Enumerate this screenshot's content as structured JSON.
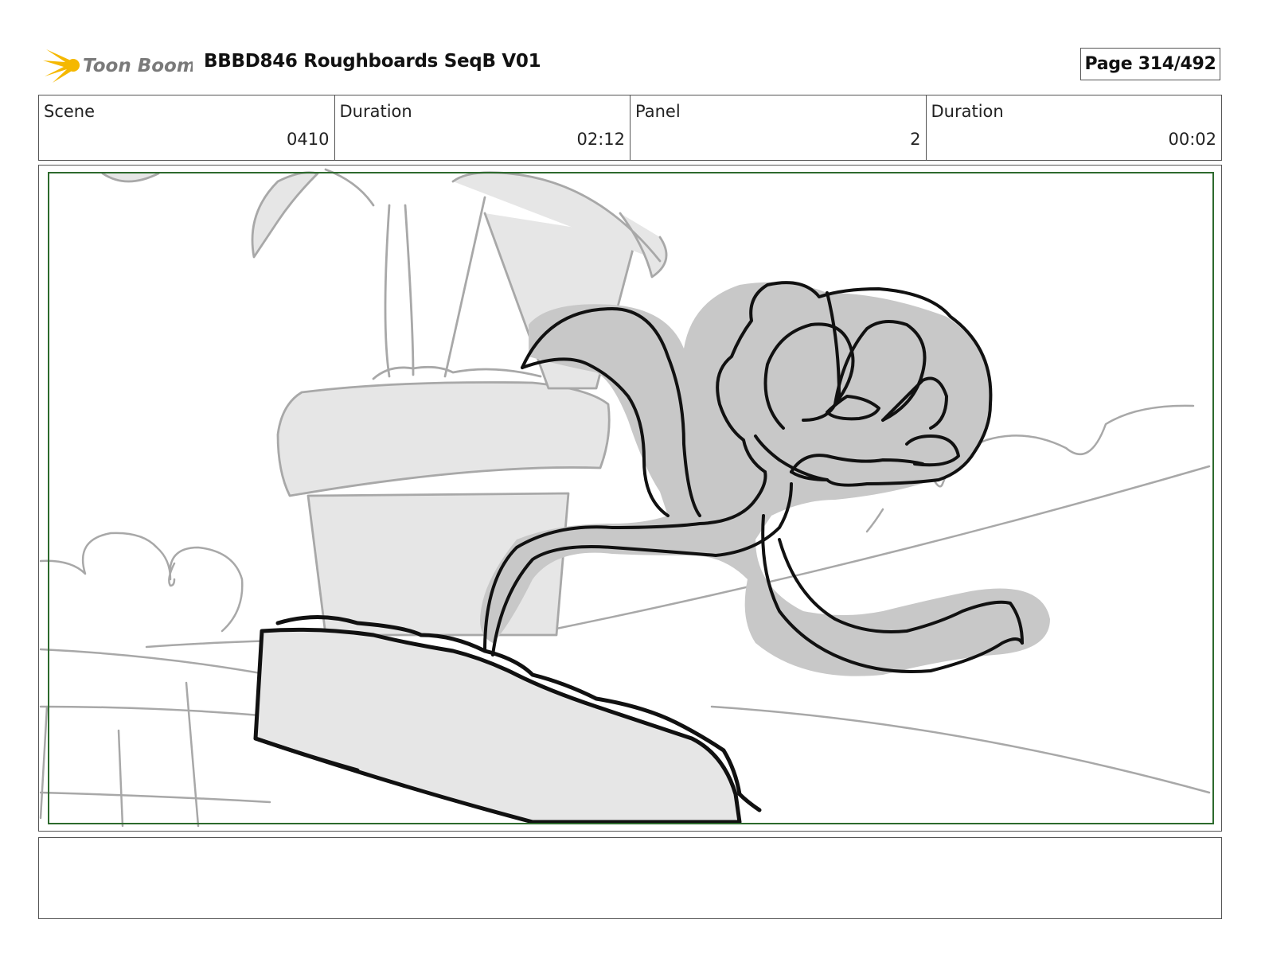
{
  "header": {
    "logo_text": "Toon Boom",
    "title": "BBBD846 Roughboards SeqB V01",
    "page": "Page 314/492"
  },
  "info": {
    "scene_label": "Scene",
    "scene_value": "0410",
    "scene_duration_label": "Duration",
    "scene_duration_value": "02:12",
    "panel_label": "Panel",
    "panel_value": "2",
    "panel_duration_label": "Duration",
    "panel_duration_value": "00:02"
  },
  "notes": {
    "text": ""
  },
  "colors": {
    "logo_yellow": "#f5b800",
    "logo_text": "#7a7a7a",
    "safe_frame": "#2d6a2d",
    "sketch_fill": "#e6e6e6",
    "flower_fill": "#c8c8c8"
  }
}
